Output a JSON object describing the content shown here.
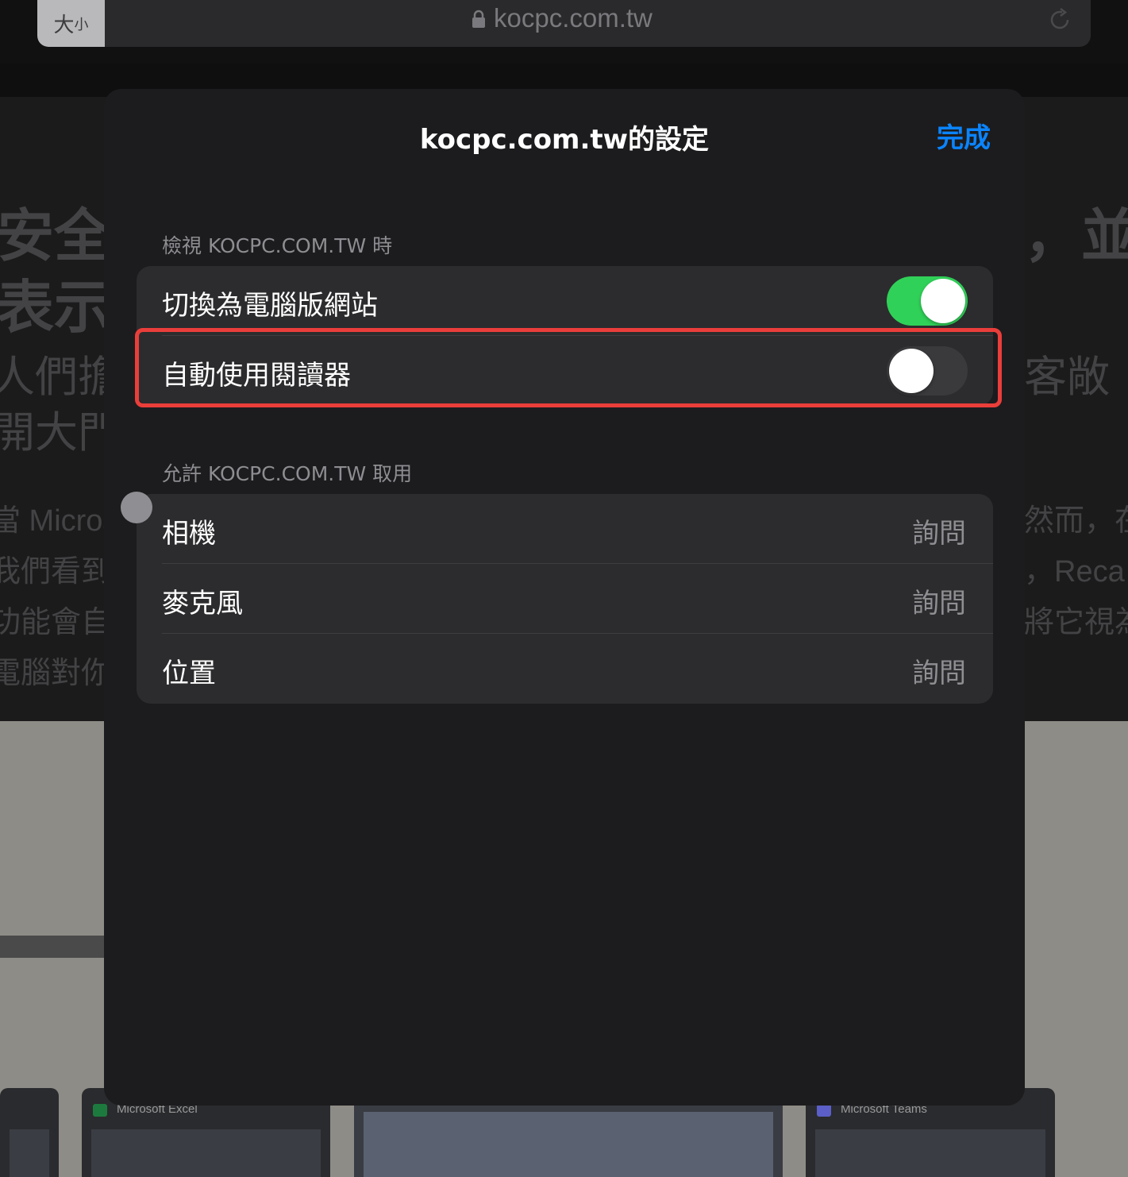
{
  "browser": {
    "size_button": "大",
    "size_button_small": "小",
    "url": "kocpc.com.tw"
  },
  "background_page": {
    "left_lines_big": [
      "安全",
      "表示"
    ],
    "left_lines_mid": [
      "人們擔",
      "開大門"
    ],
    "left_lines_small": [
      "當 Micros",
      "我們看到",
      "功能會自",
      "電腦對你"
    ],
    "right_big": "，並",
    "right_mid": "客敞",
    "right_small": [
      "然而，在",
      "，Reca",
      "將它視為"
    ],
    "thumbnails": [
      "Microsoft Excel",
      "Microsoft Teams"
    ]
  },
  "sheet": {
    "title": "kocpc.com.tw的設定",
    "done": "完成",
    "colors": {
      "accent": "#0a84ff",
      "toggle_on": "#30d158",
      "highlight": "#ea3e3a"
    },
    "view_section": {
      "header": "檢視 KOCPC.COM.TW 時",
      "rows": [
        {
          "label": "切換為電腦版網站",
          "toggle": true
        },
        {
          "label": "自動使用閱讀器",
          "toggle": false
        }
      ]
    },
    "access_section": {
      "header": "允許 KOCPC.COM.TW 取用",
      "rows": [
        {
          "label": "相機",
          "value": "詢問"
        },
        {
          "label": "麥克風",
          "value": "詢問"
        },
        {
          "label": "位置",
          "value": "詢問"
        }
      ]
    }
  }
}
